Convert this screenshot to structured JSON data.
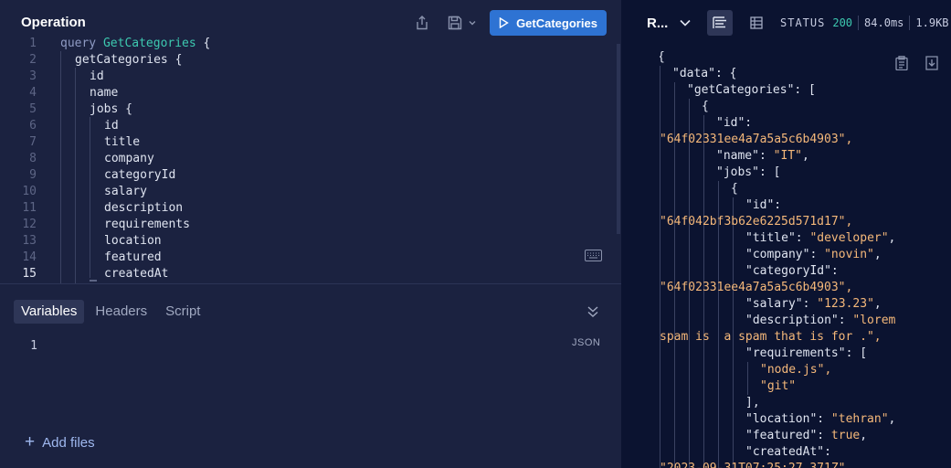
{
  "operation": {
    "title": "Operation",
    "run_label": "GetCategories",
    "icons": {
      "share": "share-icon",
      "save": "save-icon",
      "run": "play-icon",
      "keyboard": "keyboard-icon"
    },
    "lines": [
      {
        "n": "1",
        "text": "query GetCategories {"
      },
      {
        "n": "2",
        "text": "getCategories {"
      },
      {
        "n": "3",
        "text": "id"
      },
      {
        "n": "4",
        "text": "name"
      },
      {
        "n": "5",
        "text": "jobs {"
      },
      {
        "n": "6",
        "text": "id"
      },
      {
        "n": "7",
        "text": "title"
      },
      {
        "n": "8",
        "text": "company"
      },
      {
        "n": "9",
        "text": "categoryId"
      },
      {
        "n": "10",
        "text": "salary"
      },
      {
        "n": "11",
        "text": "description"
      },
      {
        "n": "12",
        "text": "requirements"
      },
      {
        "n": "13",
        "text": "location"
      },
      {
        "n": "14",
        "text": "featured"
      },
      {
        "n": "15",
        "text": "createdAt"
      }
    ]
  },
  "bottom": {
    "tabs": [
      "Variables",
      "Headers",
      "Script"
    ],
    "active_tab": "Variables",
    "line_number": "1",
    "format_label": "JSON",
    "add_files_label": "Add files"
  },
  "response": {
    "title": "R...",
    "status_label": "STATUS",
    "status_code": "200",
    "time": "84.0ms",
    "size": "1.9KB",
    "lines": [
      "{",
      "\"data\": {",
      "\"getCategories\": [",
      "{",
      "\"id\":",
      "\"64f02331ee4a7a5a5c6b4903\",",
      "\"name\": \"IT\",",
      "\"jobs\": [",
      "{",
      "\"id\":",
      "\"64f042bf3b62e6225d571d17\",",
      "\"title\": \"developer\",",
      "\"company\": \"novin\",",
      "\"categoryId\":",
      "\"64f02331ee4a7a5a5c6b4903\",",
      "\"salary\": \"123.23\",",
      "\"description\": \"lorem",
      "spam is  a spam that is for .\",",
      "\"requirements\": [",
      "\"node.js\",",
      "\"git\"",
      "],",
      "\"location\": \"tehran\",",
      "\"featured\": true,",
      "\"createdAt\":",
      "\"2023-09-31T07:25:27.371Z\""
    ]
  },
  "colors": {
    "accent": "#2e73d3",
    "status_ok": "#3dc9b0",
    "string": "#f5b87a",
    "field": "#3dc9b0"
  }
}
